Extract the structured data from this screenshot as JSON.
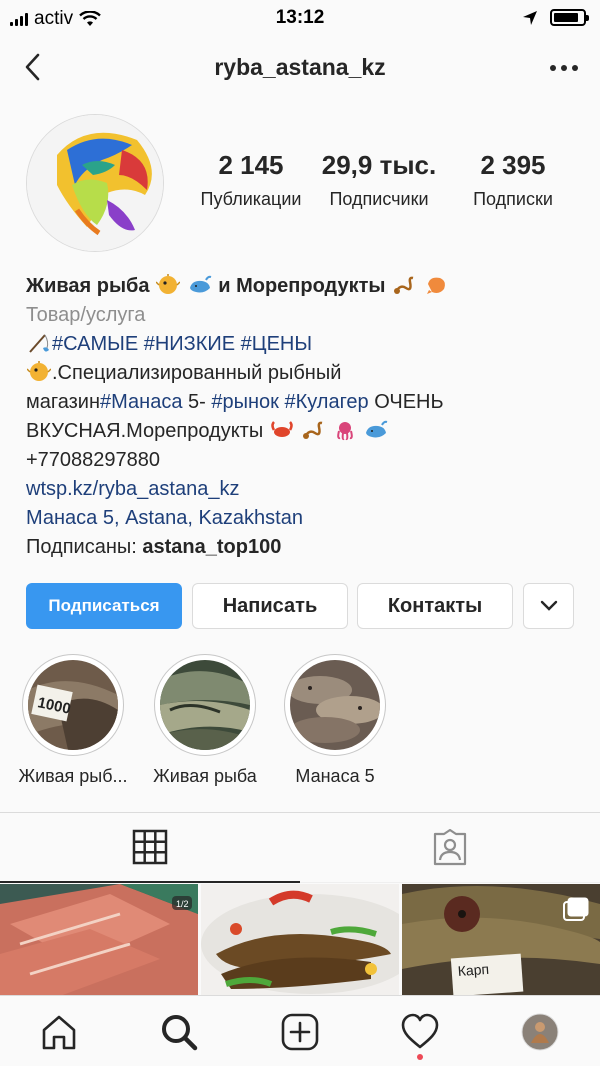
{
  "status_bar": {
    "carrier": "activ",
    "time": "13:12"
  },
  "header": {
    "username": "ryba_astana_kz"
  },
  "stats": [
    {
      "value": "2 145",
      "label": "Публикации"
    },
    {
      "value": "29,9 тыс.",
      "label": "Подписчики"
    },
    {
      "value": "2 395",
      "label": "Подписки"
    }
  ],
  "bio": {
    "name_part1": "Живая рыба",
    "name_part2": "и Морепродукты",
    "category": "Товар/услуга",
    "tags_line": "#САМЫЕ #НИЗКИЕ #ЦЕНЫ",
    "line2_text": ".Специализированный рыбный",
    "line3_text": "магазин",
    "line3_tag1": "#Манаса",
    "line3_mid": " 5- ",
    "line3_tag2": "#рынок",
    "line3_sp": " ",
    "line3_tag3": "#Кулагер",
    "line3_end": " ОЧЕНЬ",
    "line4_text": "ВКУСНАЯ.Морепродукты",
    "phone": "+77088297880",
    "website": "wtsp.kz/ryba_astana_kz",
    "address": "Манаса 5, Astana, Kazakhstan",
    "followed_by_label": "Подписаны: ",
    "followed_by_user": "astana_top100"
  },
  "buttons": {
    "follow": "Подписаться",
    "message": "Написать",
    "contacts": "Контакты"
  },
  "highlights": [
    {
      "label": "Живая рыб..."
    },
    {
      "label": "Живая рыба"
    },
    {
      "label": "Манаса 5"
    }
  ],
  "post_badge": "1/2",
  "colors": {
    "accent": "#3897f0",
    "link": "#1e3f7a",
    "notification": "#ed4956"
  },
  "icons": {
    "back": "chevron-left-icon",
    "more": "more-horizontal-icon",
    "grid": "grid-icon",
    "tagged": "tagged-user-icon",
    "home": "home-icon",
    "search": "search-icon",
    "new_post": "plus-square-icon",
    "activity": "heart-icon",
    "profile": "profile-avatar"
  }
}
